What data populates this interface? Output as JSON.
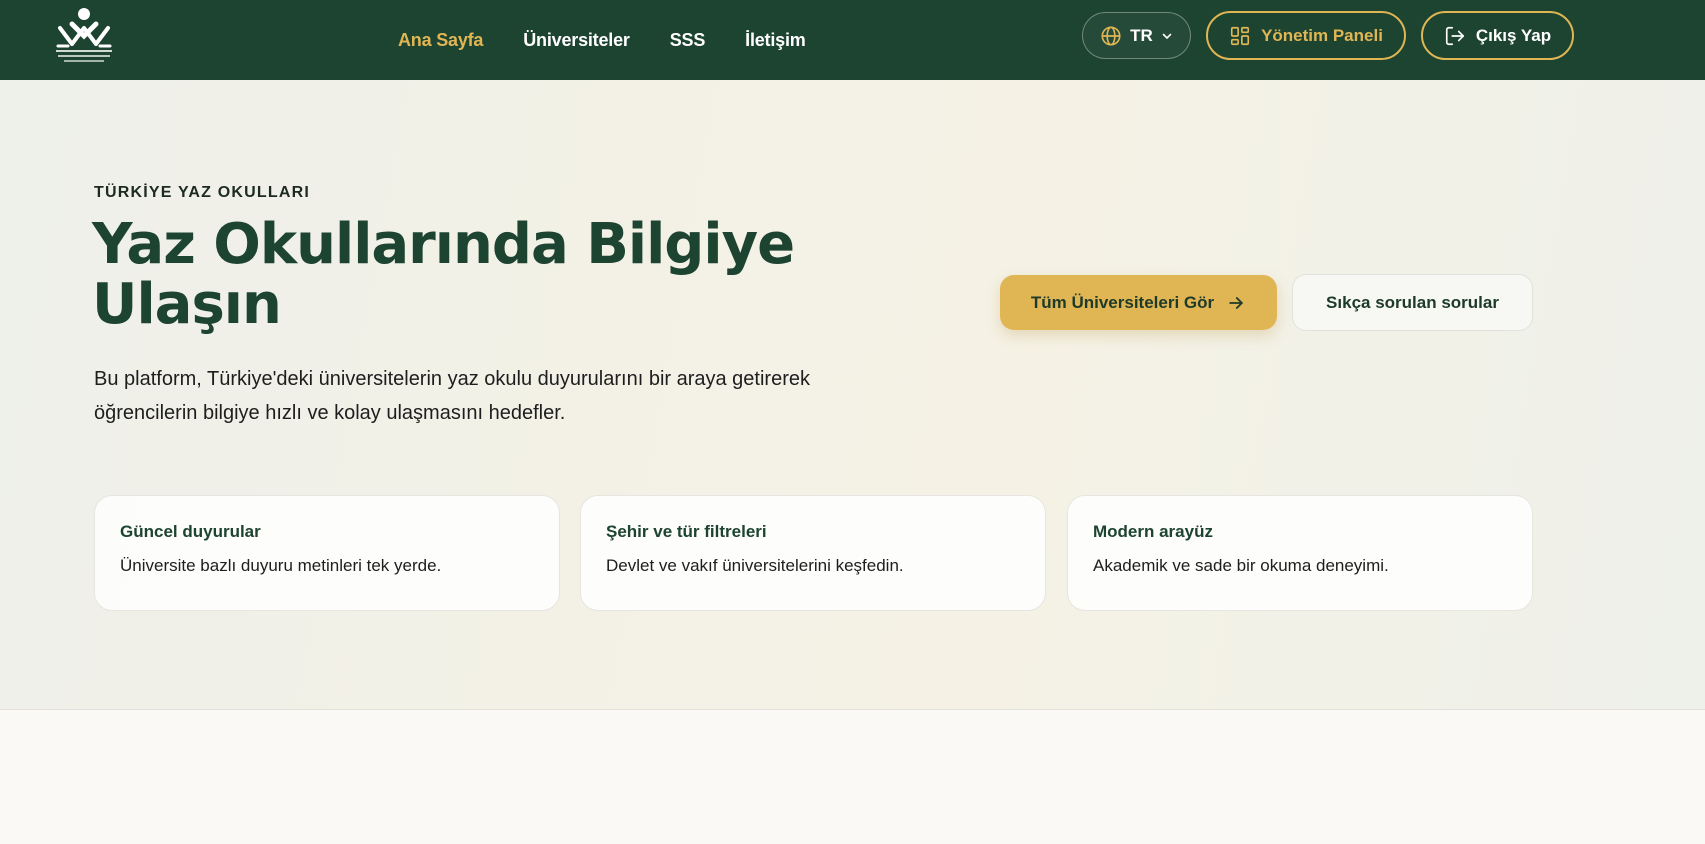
{
  "header": {
    "logo_icon": "union-logo-icon",
    "nav": [
      {
        "label": "Ana Sayfa",
        "active": true
      },
      {
        "label": "Üniversiteler",
        "active": false
      },
      {
        "label": "SSS",
        "active": false
      },
      {
        "label": "İletişim",
        "active": false
      }
    ],
    "language": {
      "label": "TR",
      "icon": "globe-icon"
    },
    "admin_button": {
      "label": "Yönetim Paneli",
      "icon": "dashboard-icon"
    },
    "logout_button": {
      "label": "Çıkış Yap",
      "icon": "logout-icon"
    }
  },
  "hero": {
    "eyebrow": "TÜRKİYE YAZ OKULLARI",
    "title_line1": "Yaz Okullarında Bilgiye",
    "title_line2": "Ulaşın",
    "lead": "Bu platform, Türkiye'deki üniversitelerin yaz okulu duyurularını bir araya getirerek öğrencilerin bilgiye hızlı ve kolay ulaşmasını hedefler.",
    "primary_cta": "Tüm Üniversiteleri Gör",
    "secondary_cta": "Sıkça sorulan sorular"
  },
  "features": [
    {
      "title": "Güncel duyurular",
      "text": "Üniversite bazlı duyuru metinleri tek yerde."
    },
    {
      "title": "Şehir ve tür filtreleri",
      "text": "Devlet ve vakıf üniversitelerini keşfedin."
    },
    {
      "title": "Modern arayüz",
      "text": "Akademik ve sade bir okuma deneyimi."
    }
  ],
  "colors": {
    "header_bg": "#1d4331",
    "accent": "#e0b654",
    "heading": "#1d4331"
  }
}
